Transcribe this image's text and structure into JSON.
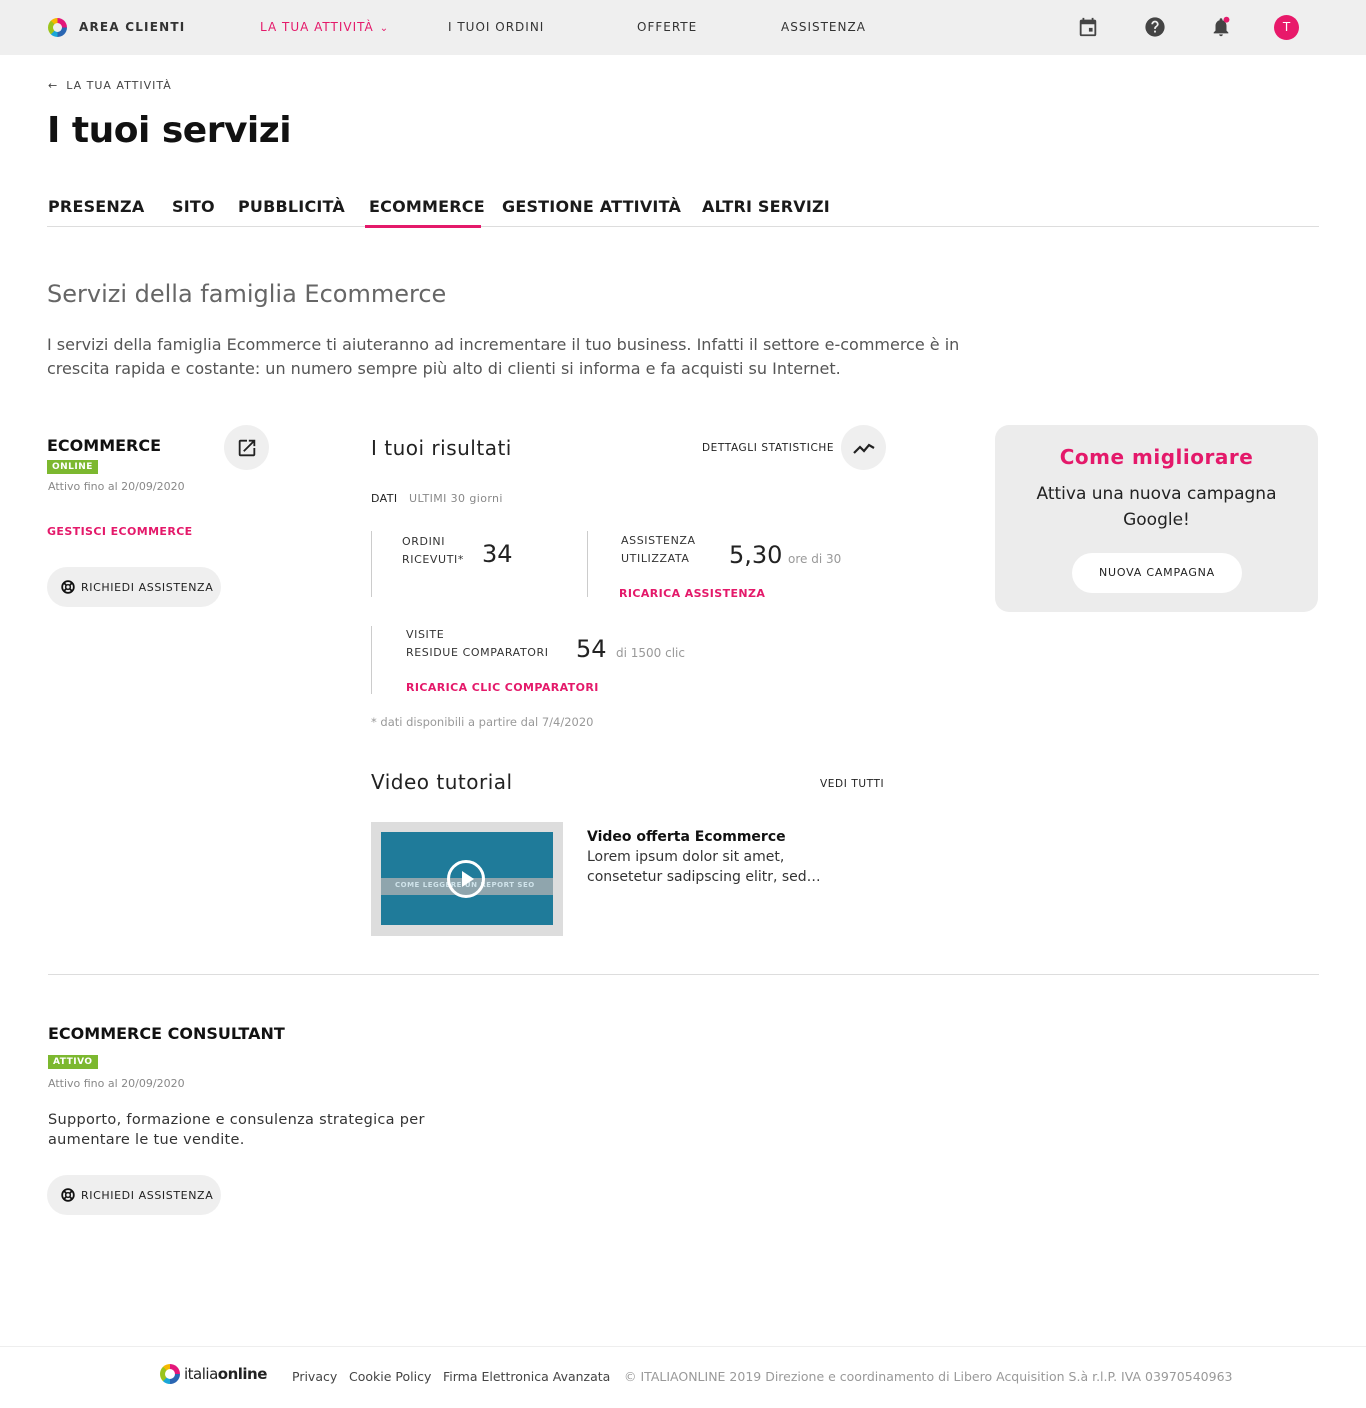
{
  "topbar": {
    "area_label": "AREA CLIENTI",
    "nav": {
      "activity": "LA TUA ATTIVITÀ",
      "orders": "I TUOI ORDINI",
      "offers": "OFFERTE",
      "assistance": "ASSISTENZA"
    },
    "icons": [
      "calendar-icon",
      "help-icon",
      "bell-icon"
    ],
    "notification_dot_color": "#e4196a",
    "avatar_initial": "T"
  },
  "breadcrumb": "LA TUA ATTIVITÀ",
  "page_title": "I tuoi servizi",
  "tabs": [
    {
      "label": "PRESENZA",
      "active": false
    },
    {
      "label": "SITO",
      "active": false
    },
    {
      "label": "PUBBLICITÀ",
      "active": false
    },
    {
      "label": "ECOMMERCE",
      "active": true
    },
    {
      "label": "GESTIONE ATTIVITÀ",
      "active": false
    },
    {
      "label": "ALTRI SERVIZI",
      "active": false
    }
  ],
  "section": {
    "title": "Servizi della famiglia Ecommerce",
    "description": "I servizi della famiglia Ecommerce ti aiuteranno ad incrementare il tuo business. Infatti il settore e-commerce è in crescita rapida e costante: un numero sempre più alto di clienti si informa e fa acquisti su Internet."
  },
  "service": {
    "name": "ECOMMERCE",
    "status": "ONLINE",
    "active_until": "Attivo fino al 20/09/2020",
    "manage_link": "GESTISCI ECOMMERCE",
    "assist_button": "RICHIEDI ASSISTENZA"
  },
  "results": {
    "title": "I tuoi risultati",
    "details_link": "DETTAGLI STATISTICHE",
    "data_label": "DATI",
    "period": "ULTIMI 30 giorni",
    "orders": {
      "label_1": "ORDINI",
      "label_2": "RICEVUTI*",
      "value": "34"
    },
    "assistance": {
      "label_1": "ASSISTENZA",
      "label_2": "UTILIZZATA",
      "value": "5,30",
      "sub": "ore di 30",
      "link": "RICARICA ASSISTENZA"
    },
    "visits": {
      "label_1": "VISITE",
      "label_2": "RESIDUE COMPARATORI",
      "value": "54",
      "sub": "di 1500 clic",
      "link": "RICARICA CLIC  COMPARATORI"
    },
    "footnote": "* dati disponibili a partire dal 7/4/2020"
  },
  "video": {
    "section_title": "Video tutorial",
    "see_all": "VEDI TUTTI",
    "thumb_caption": "COME LEGGERE UN REPORT SEO",
    "name": "Video offerta Ecommerce",
    "description": "Lorem ipsum dolor sit amet, consetetur sadipscing elitr, sed…"
  },
  "improve": {
    "title": "Come migliorare",
    "text": "Attiva una nuova campagna Google!",
    "button": "NUOVA  CAMPAGNA"
  },
  "consultant": {
    "name": "ECOMMERCE CONSULTANT",
    "status": "ATTIVO",
    "active_until": "Attivo fino al 20/09/2020",
    "description": "Supporto, formazione e consulenza strategica per aumentare le tue vendite.",
    "assist_button": "RICHIEDI ASSISTENZA"
  },
  "footer": {
    "brand_light": "italia",
    "brand_bold": "online",
    "links": [
      "Privacy",
      "Cookie Policy",
      "Firma Elettronica Avanzata"
    ],
    "copyright": "© ITALIAONLINE 2019 Direzione e coordinamento di Libero Acquisition S.à r.l.P. IVA 03970540963"
  },
  "colors": {
    "accent": "#e4196a",
    "badge_green": "#7cb82f",
    "topbar_bg": "#efefef"
  }
}
